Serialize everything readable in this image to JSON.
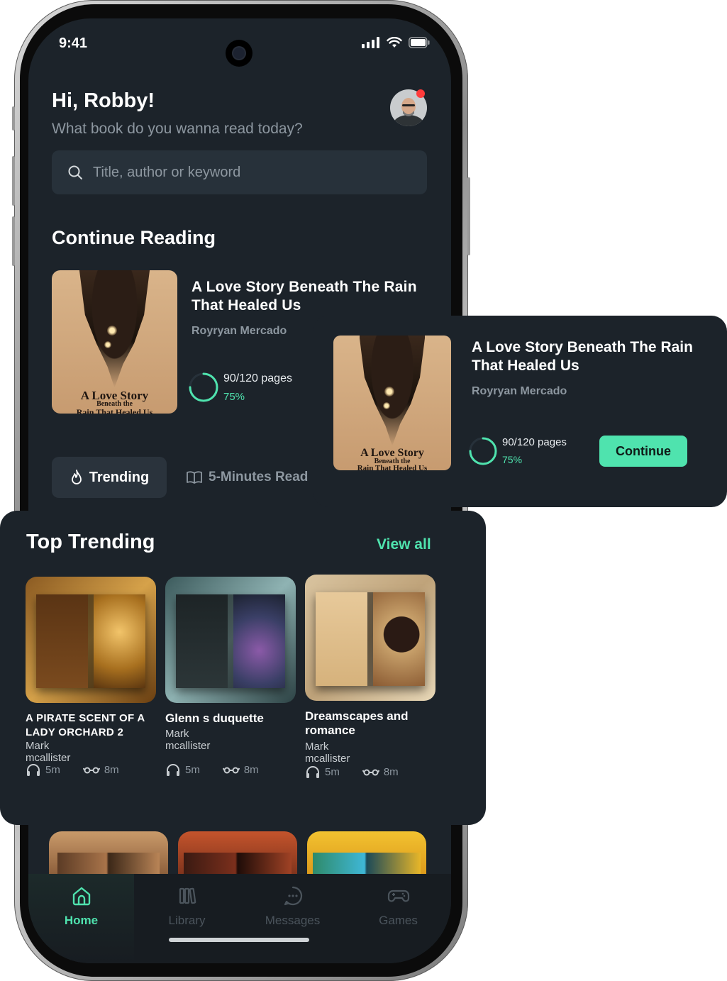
{
  "status": {
    "time": "9:41"
  },
  "header": {
    "greeting": "Hi, Robby!",
    "subtitle": "What book do you wanna read today?"
  },
  "search": {
    "placeholder": "Title, author or keyword"
  },
  "continue_reading": {
    "section_title": "Continue Reading",
    "book": {
      "title": "A Love Story Beneath The Rain That Healed Us",
      "author": "Royryan Mercado",
      "cover_title_line1": "A Love Story",
      "cover_title_line2": "Beneath the",
      "cover_title_line3": "Rain That Healed Us",
      "pages": "90/120 pages",
      "percent": "75%",
      "progress": 0.75
    }
  },
  "tabs": {
    "trending": "Trending",
    "five_minutes": "5-Minutes Read"
  },
  "floating_card": {
    "title": "A Love Story Beneath The Rain That Healed Us",
    "author": "Royryan Mercado",
    "pages": "90/120 pages",
    "percent": "75%",
    "progress": 0.75,
    "button": "Continue"
  },
  "top_trending": {
    "title": "Top Trending",
    "view_all": "View all",
    "books": [
      {
        "title": "A PIRATE SCENT OF A LADY ORCHARD 2",
        "author": "Mark mcallister",
        "listen": "5m",
        "read": "8m"
      },
      {
        "title": "Glenn s duquette",
        "author": "Mark mcallister",
        "listen": "5m",
        "read": "8m"
      },
      {
        "title": "Dreamscapes and romance",
        "author": "Mark mcallister",
        "listen": "5m",
        "read": "8m"
      }
    ]
  },
  "nav": {
    "items": [
      {
        "label": "Home",
        "icon": "home-icon",
        "active": true
      },
      {
        "label": "Library",
        "icon": "library-icon",
        "active": false
      },
      {
        "label": "Messages",
        "icon": "messages-icon",
        "active": false
      },
      {
        "label": "Games",
        "icon": "games-icon",
        "active": false
      }
    ]
  },
  "colors": {
    "accent": "#4fe3ae",
    "background": "#1c232a",
    "surface": "#27313a",
    "notification": "#ff3b3b"
  }
}
